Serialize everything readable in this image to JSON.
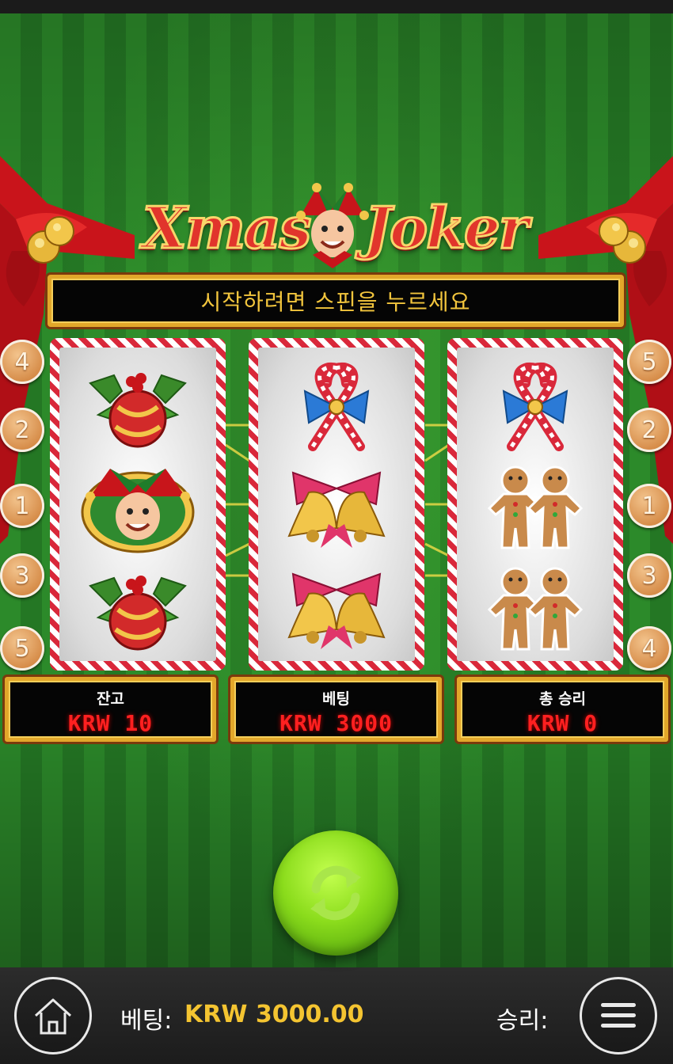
{
  "logo": {
    "word1": "Xmas",
    "word2": "Joker"
  },
  "message": "시작하려면 스핀을 누르세요",
  "left_badges": [
    "4",
    "2",
    "1",
    "3",
    "5"
  ],
  "right_badges": [
    "5",
    "2",
    "1",
    "3",
    "4"
  ],
  "reels": [
    [
      "ornament-holly",
      "joker",
      "ornament-holly"
    ],
    [
      "candy-canes-bow",
      "bells",
      "bells"
    ],
    [
      "candy-canes-bow",
      "gingerbread-men",
      "gingerbread-men"
    ]
  ],
  "info": {
    "balance": {
      "label": "잔고",
      "value": "KRW 10"
    },
    "bet": {
      "label": "베팅",
      "value": "KRW 3000"
    },
    "total_win": {
      "label": "총 승리",
      "value": "KRW 0"
    }
  },
  "bottom_bar": {
    "bet_label": "베팅:",
    "bet_value": "KRW 3000.00",
    "win_label": "승리:"
  },
  "icons": {
    "home": "home-icon",
    "menu": "hamburger-menu-icon",
    "spin": "refresh-arrows-icon"
  },
  "colors": {
    "gold_frame": "#e2a72a",
    "message_text": "#f2c53d",
    "led_red": "#ff2020",
    "spin_green": "#8bdc1c",
    "bet_value": "#f4c431"
  }
}
